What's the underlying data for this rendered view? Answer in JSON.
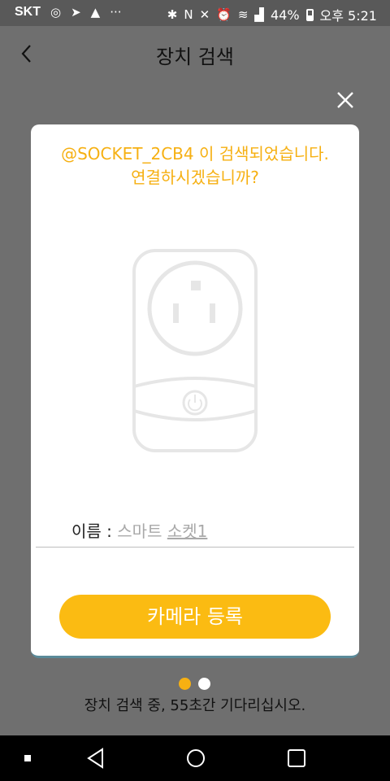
{
  "status_bar": {
    "carrier": "SKT",
    "overflow": "···",
    "battery_percent": "44%",
    "time": "오후 5:21"
  },
  "header": {
    "title": "장치 검색"
  },
  "dialog": {
    "message_line1": "@SOCKET_2CB4 이 검색되었습니다.",
    "message_line2": "연결하시겠습니까?",
    "name_label": "이름 : ",
    "name_value_part1": "스마트 ",
    "name_value_part2": "소켓1",
    "register_button": "카메라 등록"
  },
  "pager": {
    "total": 2,
    "current": 1
  },
  "search_status": "장치 검색 중, 55초간 기다리십시오.",
  "colors": {
    "accent": "#f6b012",
    "button": "#fbbb12",
    "overlay": "#6f6f6f"
  }
}
